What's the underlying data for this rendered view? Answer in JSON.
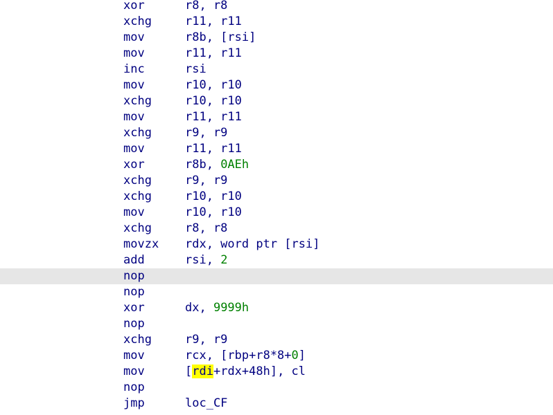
{
  "colors": {
    "background": "#ffffff",
    "text": "#000080",
    "number": "#008000",
    "current_line": "#e6e6e6",
    "highlight": "#ffff00"
  },
  "listing": {
    "current_line_index": 17,
    "lines": [
      {
        "mnemonic": "xor",
        "operands": [
          {
            "t": "r8, r8"
          }
        ]
      },
      {
        "mnemonic": "xchg",
        "operands": [
          {
            "t": "r11, r11"
          }
        ]
      },
      {
        "mnemonic": "mov",
        "operands": [
          {
            "t": "r8b, [rsi]"
          }
        ]
      },
      {
        "mnemonic": "mov",
        "operands": [
          {
            "t": "r11, r11"
          }
        ]
      },
      {
        "mnemonic": "inc",
        "operands": [
          {
            "t": "rsi"
          }
        ]
      },
      {
        "mnemonic": "mov",
        "operands": [
          {
            "t": "r10, r10"
          }
        ]
      },
      {
        "mnemonic": "xchg",
        "operands": [
          {
            "t": "r10, r10"
          }
        ]
      },
      {
        "mnemonic": "mov",
        "operands": [
          {
            "t": "r11, r11"
          }
        ]
      },
      {
        "mnemonic": "xchg",
        "operands": [
          {
            "t": "r9, r9"
          }
        ]
      },
      {
        "mnemonic": "mov",
        "operands": [
          {
            "t": "r11, r11"
          }
        ]
      },
      {
        "mnemonic": "xor",
        "operands": [
          {
            "t": "r8b, "
          },
          {
            "t": "0AEh",
            "k": "num"
          }
        ]
      },
      {
        "mnemonic": "xchg",
        "operands": [
          {
            "t": "r9, r9"
          }
        ]
      },
      {
        "mnemonic": "xchg",
        "operands": [
          {
            "t": "r10, r10"
          }
        ]
      },
      {
        "mnemonic": "mov",
        "operands": [
          {
            "t": "r10, r10"
          }
        ]
      },
      {
        "mnemonic": "xchg",
        "operands": [
          {
            "t": "r8, r8"
          }
        ]
      },
      {
        "mnemonic": "movzx",
        "operands": [
          {
            "t": "rdx, word ptr [rsi]"
          }
        ]
      },
      {
        "mnemonic": "add",
        "operands": [
          {
            "t": "rsi, "
          },
          {
            "t": "2",
            "k": "num"
          }
        ]
      },
      {
        "mnemonic": "nop",
        "operands": []
      },
      {
        "mnemonic": "nop",
        "operands": []
      },
      {
        "mnemonic": "xor",
        "operands": [
          {
            "t": "dx, "
          },
          {
            "t": "9999h",
            "k": "num"
          }
        ]
      },
      {
        "mnemonic": "nop",
        "operands": []
      },
      {
        "mnemonic": "xchg",
        "operands": [
          {
            "t": "r9, r9"
          }
        ]
      },
      {
        "mnemonic": "mov",
        "operands": [
          {
            "t": "rcx, [rbp+r8*8+"
          },
          {
            "t": "0",
            "k": "num"
          },
          {
            "t": "]"
          }
        ]
      },
      {
        "mnemonic": "mov",
        "operands": [
          {
            "t": "["
          },
          {
            "t": "rdi",
            "k": "hl"
          },
          {
            "t": "+rdx+48h], cl"
          }
        ]
      },
      {
        "mnemonic": "nop",
        "operands": []
      },
      {
        "mnemonic": "jmp",
        "operands": [
          {
            "t": "loc_CF"
          }
        ]
      }
    ]
  }
}
